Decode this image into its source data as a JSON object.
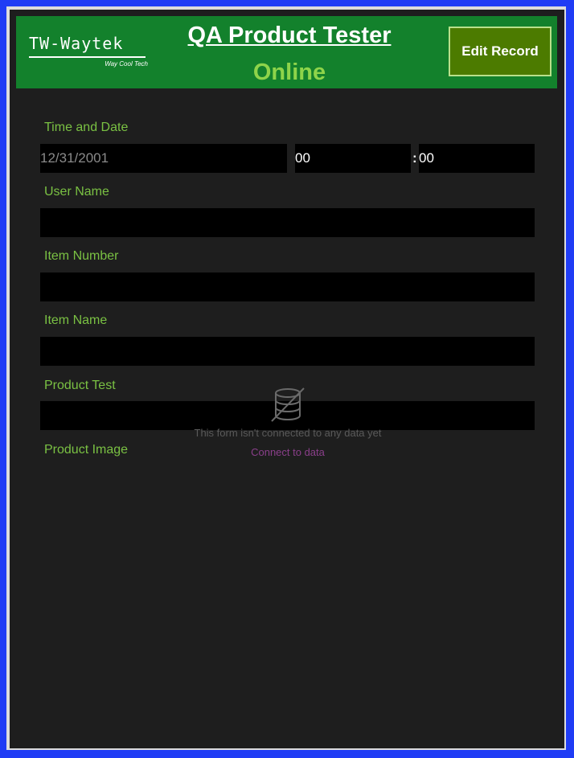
{
  "header": {
    "logo_text": "TW-Waytek",
    "logo_tagline": "Way Cool Tech",
    "title": "QA Product Tester",
    "status": "Online",
    "edit_button_label": "Edit Record"
  },
  "form": {
    "time_date_label": "Time and Date",
    "date_placeholder": "12/31/2001",
    "hour_value": "00",
    "colon": ":",
    "minute_value": "00",
    "user_name_label": "User Name",
    "item_number_label": "Item Number",
    "item_name_label": "Item Name",
    "product_test_label": "Product Test",
    "product_image_label": "Product Image"
  },
  "empty_state": {
    "icon": "database-off-icon",
    "message": "This form isn't connected to any data yet",
    "link_label": "Connect to data"
  },
  "colors": {
    "frame": "#1f3cf5",
    "header_bg": "#13812c",
    "status_green": "#8ed44a",
    "label_green": "#7ac143",
    "button_bg": "#4c7b00",
    "link_purple": "#8a3f8a"
  }
}
